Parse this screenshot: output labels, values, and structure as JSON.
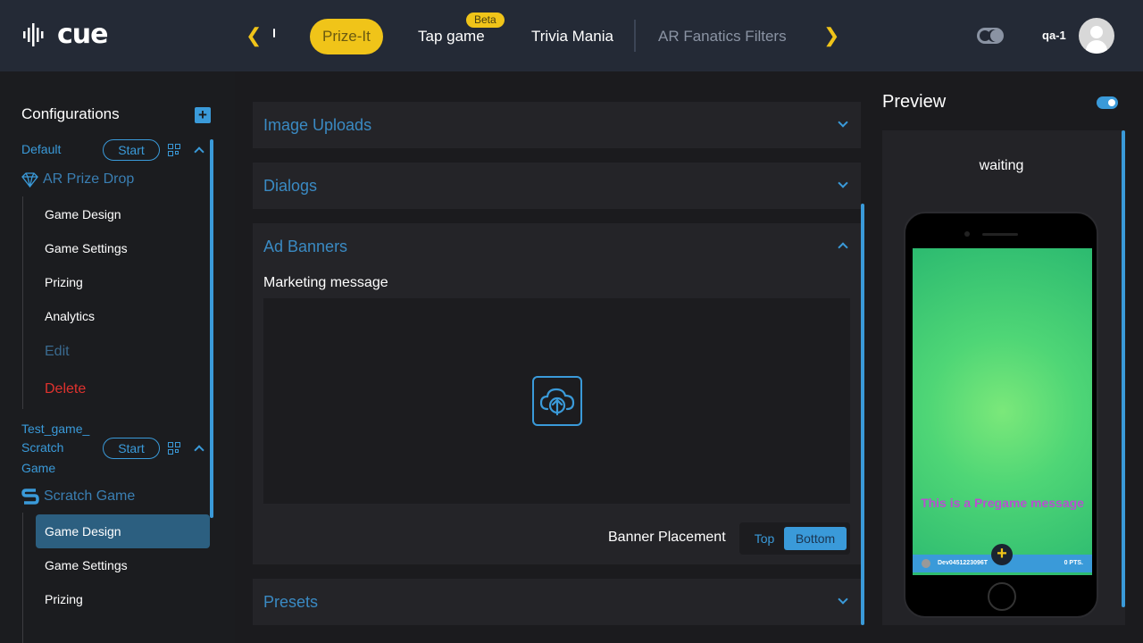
{
  "app": {
    "logo_text": "cue"
  },
  "nav": {
    "tabs": [
      {
        "label": "Prize-It",
        "active": true
      },
      {
        "label": "Tap game",
        "badge": "Beta"
      },
      {
        "label": "Trivia Mania"
      },
      {
        "label": "AR Fanatics Filters"
      }
    ],
    "user": "qa-1"
  },
  "sidebar": {
    "title": "Configurations",
    "configs": [
      {
        "name": "Default",
        "start_label": "Start",
        "game_type": "AR Prize Drop",
        "items": [
          "Game Design",
          "Game Settings",
          "Prizing",
          "Analytics",
          "Edit",
          "Delete"
        ]
      },
      {
        "name_lines": [
          "Test_game_",
          "Scratch",
          "Game"
        ],
        "start_label": "Start",
        "game_type": "Scratch Game",
        "items": [
          "Game Design",
          "Game Settings",
          "Prizing"
        ],
        "selected": "Game Design"
      }
    ]
  },
  "main": {
    "sections": [
      {
        "title": "Image Uploads",
        "expanded": false
      },
      {
        "title": "Dialogs",
        "expanded": false
      },
      {
        "title": "Ad Banners",
        "expanded": true
      },
      {
        "title": "Presets",
        "expanded": false
      }
    ],
    "ad_banners": {
      "field_label": "Marketing message",
      "placement_label": "Banner Placement",
      "placement_options": [
        "Top",
        "Bottom"
      ],
      "placement_selected": "Bottom"
    }
  },
  "preview": {
    "title": "Preview",
    "status": "waiting",
    "pregame_message": "This is a Pregame message",
    "device_id": "Dev0451223096T",
    "points": "0 PTS."
  },
  "colors": {
    "accent": "#3a9ad9",
    "brand_yellow": "#f0c419",
    "danger": "#e0322e"
  }
}
